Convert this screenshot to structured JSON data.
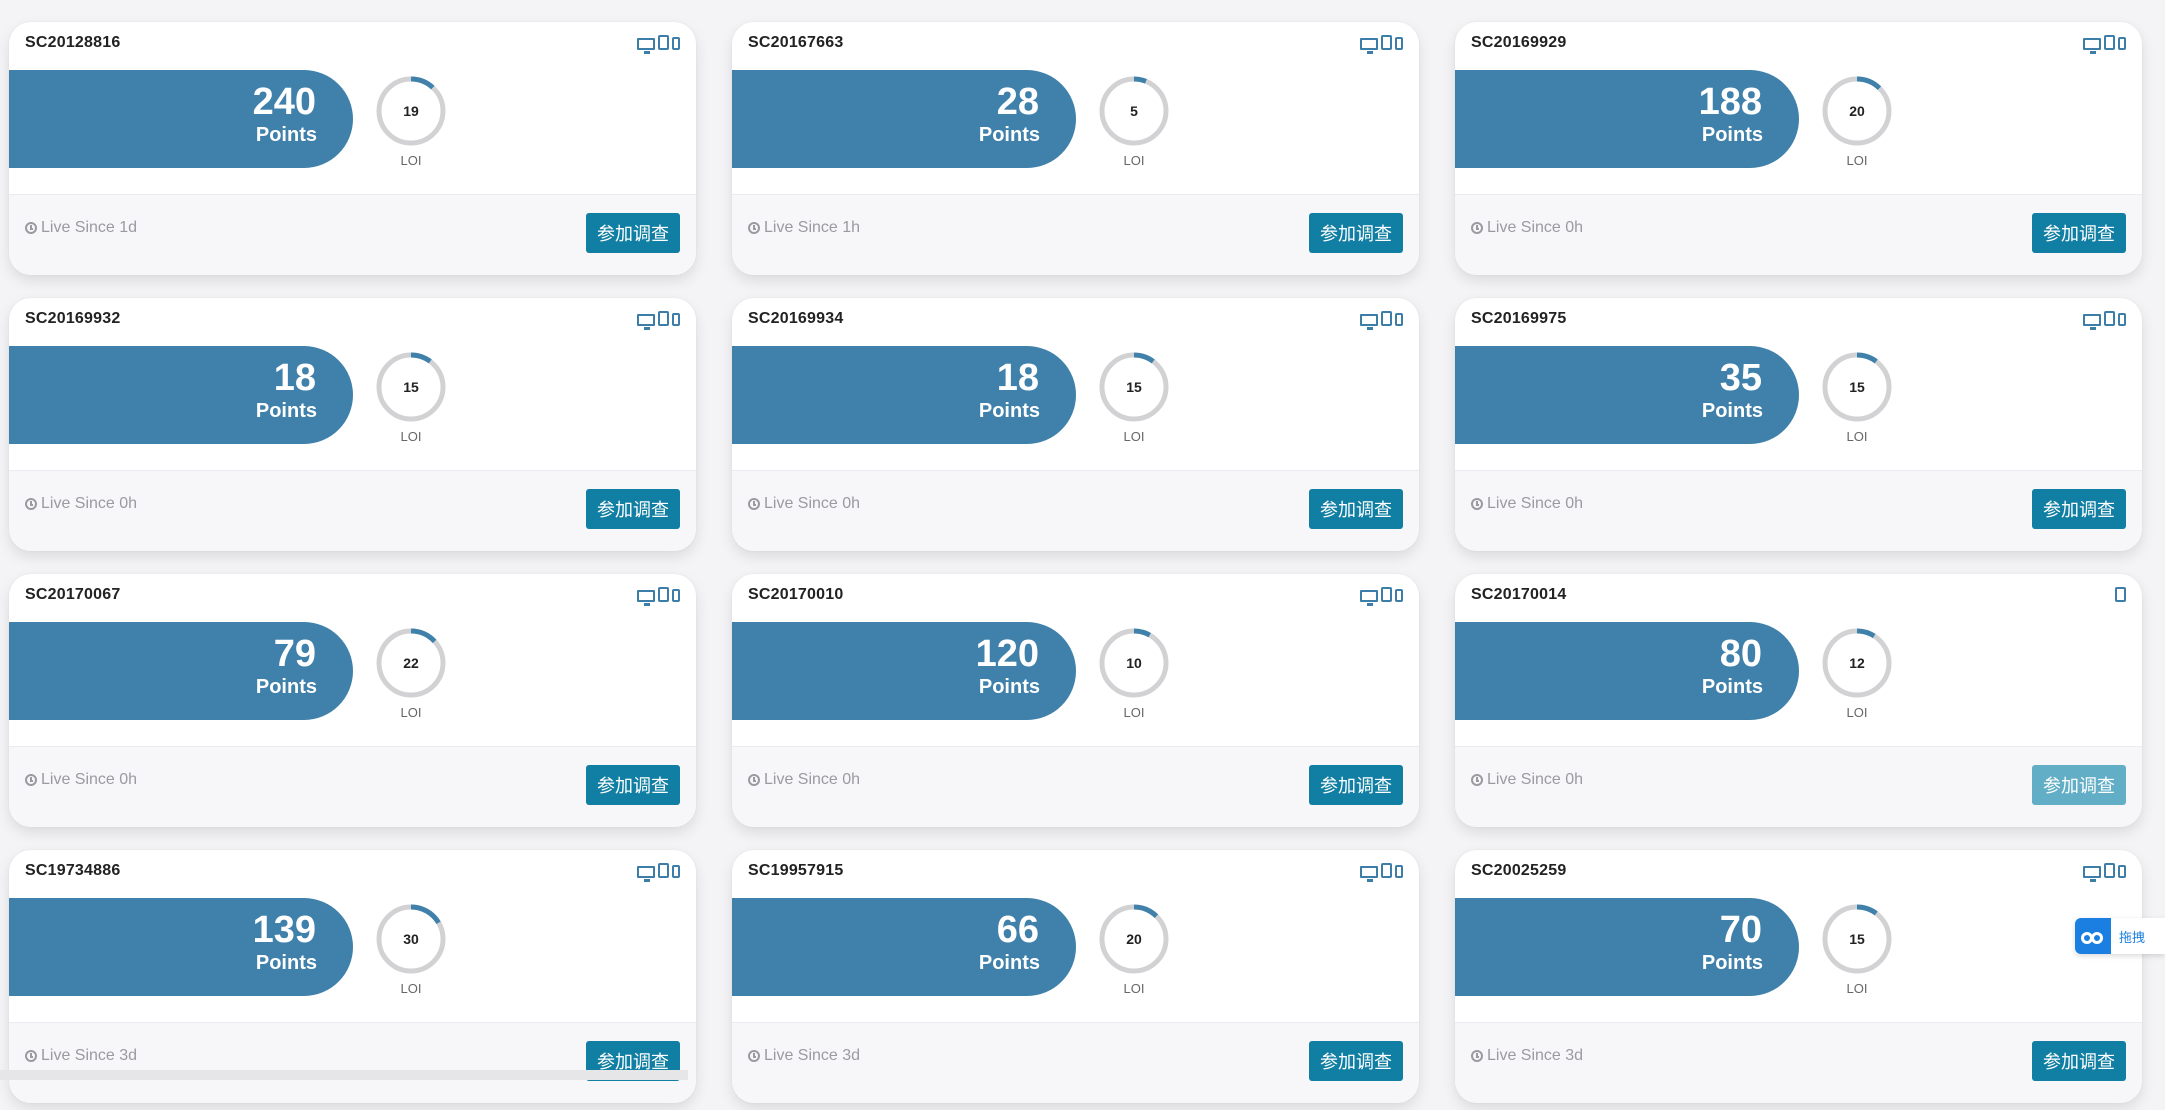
{
  "button_label": "参加调查",
  "points_label": "Points",
  "loi_label": "LOI",
  "colors": {
    "accent": "#3f81ab",
    "button": "#117fa3",
    "button_disabled": "#62aec6",
    "ring_track": "#d2d2d4",
    "ring_progress": "#3f81ab"
  },
  "surveys": [
    {
      "id": "SC20128816",
      "points": "240",
      "loi": "19",
      "live": "Live Since 1d",
      "devices": [
        "desktop-icon",
        "tablet-icon",
        "phone-icon"
      ],
      "enabled": true
    },
    {
      "id": "SC20167663",
      "points": "28",
      "loi": "5",
      "live": "Live Since 1h",
      "devices": [
        "desktop-icon",
        "tablet-icon",
        "phone-icon"
      ],
      "enabled": true
    },
    {
      "id": "SC20169929",
      "points": "188",
      "loi": "20",
      "live": "Live Since 0h",
      "devices": [
        "desktop-icon",
        "tablet-icon",
        "phone-icon"
      ],
      "enabled": true
    },
    {
      "id": "SC20169932",
      "points": "18",
      "loi": "15",
      "live": "Live Since 0h",
      "devices": [
        "desktop-icon",
        "tablet-icon",
        "phone-icon"
      ],
      "enabled": true
    },
    {
      "id": "SC20169934",
      "points": "18",
      "loi": "15",
      "live": "Live Since 0h",
      "devices": [
        "desktop-icon",
        "tablet-icon",
        "phone-icon"
      ],
      "enabled": true
    },
    {
      "id": "SC20169975",
      "points": "35",
      "loi": "15",
      "live": "Live Since 0h",
      "devices": [
        "desktop-icon",
        "tablet-icon",
        "phone-icon"
      ],
      "enabled": true
    },
    {
      "id": "SC20170067",
      "points": "79",
      "loi": "22",
      "live": "Live Since 0h",
      "devices": [
        "desktop-icon",
        "tablet-icon",
        "phone-icon"
      ],
      "enabled": true
    },
    {
      "id": "SC20170010",
      "points": "120",
      "loi": "10",
      "live": "Live Since 0h",
      "devices": [
        "desktop-icon",
        "tablet-icon",
        "phone-icon"
      ],
      "enabled": true
    },
    {
      "id": "SC20170014",
      "points": "80",
      "loi": "12",
      "live": "Live Since 0h",
      "devices": [
        "tablet-icon"
      ],
      "enabled": false
    },
    {
      "id": "SC19734886",
      "points": "139",
      "loi": "30",
      "live": "Live Since 3d",
      "devices": [
        "desktop-icon",
        "tablet-icon",
        "phone-icon"
      ],
      "enabled": true
    },
    {
      "id": "SC19957915",
      "points": "66",
      "loi": "20",
      "live": "Live Since 3d",
      "devices": [
        "desktop-icon",
        "tablet-icon",
        "phone-icon"
      ],
      "enabled": true
    },
    {
      "id": "SC20025259",
      "points": "70",
      "loi": "15",
      "live": "Live Since 3d",
      "devices": [
        "desktop-icon",
        "tablet-icon",
        "phone-icon"
      ],
      "enabled": true
    }
  ],
  "float_widget": {
    "label": "拖拽"
  }
}
